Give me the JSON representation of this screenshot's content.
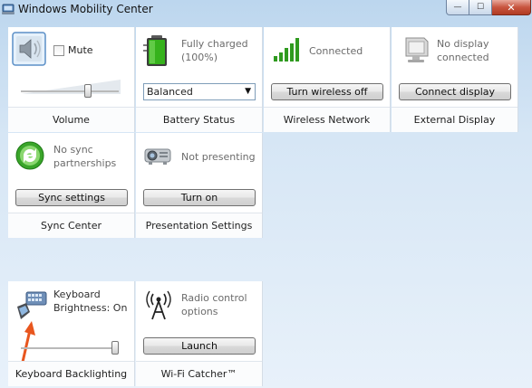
{
  "window": {
    "title": "Windows Mobility Center",
    "minimize_glyph": "—",
    "maximize_glyph": "☐",
    "close_glyph": "✕"
  },
  "tiles": {
    "volume": {
      "mute_label": "Mute",
      "level": 0.7,
      "footer": "Volume",
      "icon": "speaker-icon"
    },
    "battery": {
      "status": "Fully charged (100%)",
      "plan": "Balanced",
      "footer": "Battery Status",
      "icon": "battery-icon"
    },
    "wireless": {
      "status": "Connected",
      "button": "Turn wireless off",
      "footer": "Wireless Network",
      "icon": "signal-bars-icon"
    },
    "display": {
      "status": "No display connected",
      "button": "Connect display",
      "footer": "External Display",
      "icon": "monitor-icon"
    },
    "sync": {
      "status": "No sync partnerships",
      "button": "Sync settings",
      "footer": "Sync Center",
      "icon": "sync-arrows-icon"
    },
    "presentation": {
      "status": "Not presenting",
      "button": "Turn on",
      "footer": "Presentation Settings",
      "icon": "projector-icon"
    },
    "keyboard": {
      "status": "Keyboard Brightness: On",
      "level": 1.0,
      "footer": "Keyboard Backlighting",
      "icon": "keyboard-light-icon"
    },
    "wifi_catcher": {
      "status": "Radio control options",
      "button": "Launch",
      "footer": "Wi-Fi Catcher™",
      "icon": "antenna-icon"
    }
  },
  "colors": {
    "background_top": "#bcd6ee",
    "battery_green": "#36b21c",
    "signal_green": "#2f9a1f",
    "sync_green": "#3aa52a",
    "arrow_orange": "#e8561e",
    "close_red": "#c8553f"
  }
}
